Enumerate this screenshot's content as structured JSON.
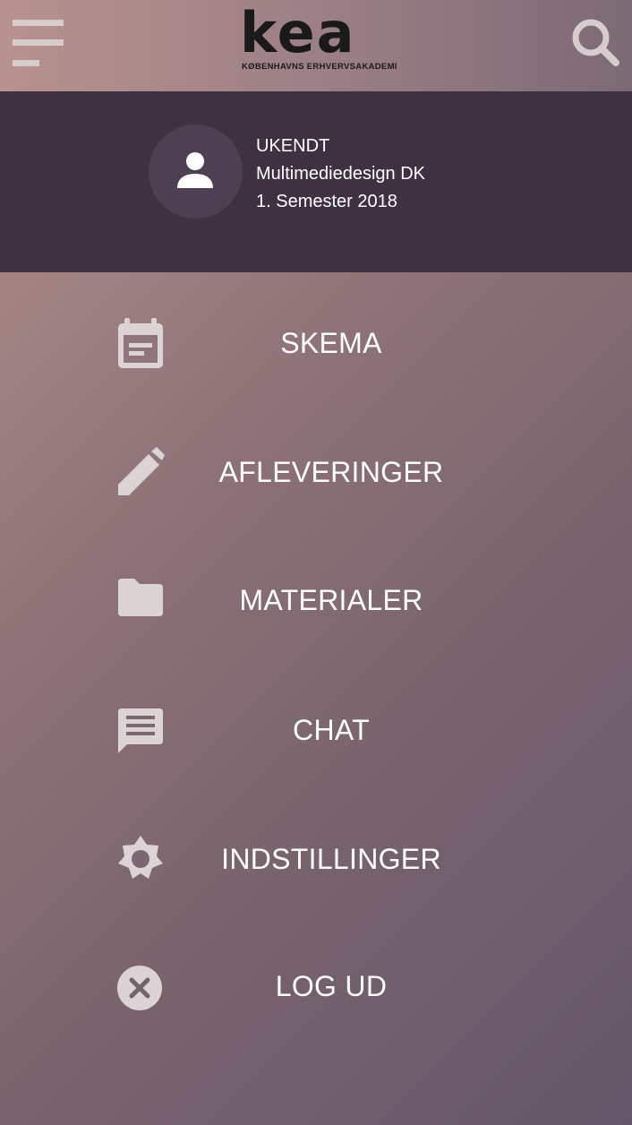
{
  "header": {
    "logo_word": "kea",
    "logo_subtitle": "KØBENHAVNS ERHVERVSAKADEMI",
    "menu_icon": "hamburger-menu-icon",
    "search_icon": "search-icon"
  },
  "profile": {
    "name": "UKENDT",
    "program": "Multimediedesign DK",
    "semester": "1. Semester 2018",
    "avatar_icon": "person-icon"
  },
  "nav": {
    "items": [
      {
        "label": "SKEMA",
        "icon": "calendar-icon"
      },
      {
        "label": "AFLEVERINGER",
        "icon": "pencil-icon"
      },
      {
        "label": "MATERIALER",
        "icon": "folder-icon"
      },
      {
        "label": "CHAT",
        "icon": "chat-icon"
      },
      {
        "label": "INDSTILLINGER",
        "icon": "gear-icon"
      },
      {
        "label": "LOG UD",
        "icon": "close-circle-icon"
      }
    ]
  },
  "colors": {
    "profile_bg": "#3e3242",
    "avatar_bg": "#4e4052",
    "icon_color": "#dcd3d5",
    "text": "#ffffff"
  }
}
